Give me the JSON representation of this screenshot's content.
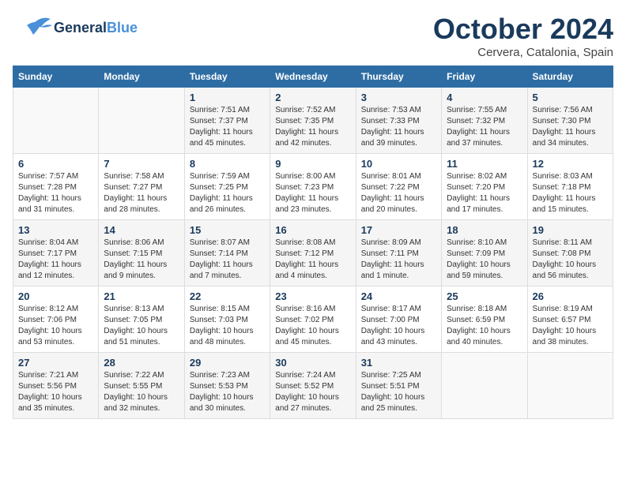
{
  "logo": {
    "general": "General",
    "blue": "Blue"
  },
  "header": {
    "month": "October 2024",
    "location": "Cervera, Catalonia, Spain"
  },
  "weekdays": [
    "Sunday",
    "Monday",
    "Tuesday",
    "Wednesday",
    "Thursday",
    "Friday",
    "Saturday"
  ],
  "weeks": [
    [
      {
        "day": "",
        "info": ""
      },
      {
        "day": "",
        "info": ""
      },
      {
        "day": "1",
        "info": "Sunrise: 7:51 AM\nSunset: 7:37 PM\nDaylight: 11 hours and 45 minutes."
      },
      {
        "day": "2",
        "info": "Sunrise: 7:52 AM\nSunset: 7:35 PM\nDaylight: 11 hours and 42 minutes."
      },
      {
        "day": "3",
        "info": "Sunrise: 7:53 AM\nSunset: 7:33 PM\nDaylight: 11 hours and 39 minutes."
      },
      {
        "day": "4",
        "info": "Sunrise: 7:55 AM\nSunset: 7:32 PM\nDaylight: 11 hours and 37 minutes."
      },
      {
        "day": "5",
        "info": "Sunrise: 7:56 AM\nSunset: 7:30 PM\nDaylight: 11 hours and 34 minutes."
      }
    ],
    [
      {
        "day": "6",
        "info": "Sunrise: 7:57 AM\nSunset: 7:28 PM\nDaylight: 11 hours and 31 minutes."
      },
      {
        "day": "7",
        "info": "Sunrise: 7:58 AM\nSunset: 7:27 PM\nDaylight: 11 hours and 28 minutes."
      },
      {
        "day": "8",
        "info": "Sunrise: 7:59 AM\nSunset: 7:25 PM\nDaylight: 11 hours and 26 minutes."
      },
      {
        "day": "9",
        "info": "Sunrise: 8:00 AM\nSunset: 7:23 PM\nDaylight: 11 hours and 23 minutes."
      },
      {
        "day": "10",
        "info": "Sunrise: 8:01 AM\nSunset: 7:22 PM\nDaylight: 11 hours and 20 minutes."
      },
      {
        "day": "11",
        "info": "Sunrise: 8:02 AM\nSunset: 7:20 PM\nDaylight: 11 hours and 17 minutes."
      },
      {
        "day": "12",
        "info": "Sunrise: 8:03 AM\nSunset: 7:18 PM\nDaylight: 11 hours and 15 minutes."
      }
    ],
    [
      {
        "day": "13",
        "info": "Sunrise: 8:04 AM\nSunset: 7:17 PM\nDaylight: 11 hours and 12 minutes."
      },
      {
        "day": "14",
        "info": "Sunrise: 8:06 AM\nSunset: 7:15 PM\nDaylight: 11 hours and 9 minutes."
      },
      {
        "day": "15",
        "info": "Sunrise: 8:07 AM\nSunset: 7:14 PM\nDaylight: 11 hours and 7 minutes."
      },
      {
        "day": "16",
        "info": "Sunrise: 8:08 AM\nSunset: 7:12 PM\nDaylight: 11 hours and 4 minutes."
      },
      {
        "day": "17",
        "info": "Sunrise: 8:09 AM\nSunset: 7:11 PM\nDaylight: 11 hours and 1 minute."
      },
      {
        "day": "18",
        "info": "Sunrise: 8:10 AM\nSunset: 7:09 PM\nDaylight: 10 hours and 59 minutes."
      },
      {
        "day": "19",
        "info": "Sunrise: 8:11 AM\nSunset: 7:08 PM\nDaylight: 10 hours and 56 minutes."
      }
    ],
    [
      {
        "day": "20",
        "info": "Sunrise: 8:12 AM\nSunset: 7:06 PM\nDaylight: 10 hours and 53 minutes."
      },
      {
        "day": "21",
        "info": "Sunrise: 8:13 AM\nSunset: 7:05 PM\nDaylight: 10 hours and 51 minutes."
      },
      {
        "day": "22",
        "info": "Sunrise: 8:15 AM\nSunset: 7:03 PM\nDaylight: 10 hours and 48 minutes."
      },
      {
        "day": "23",
        "info": "Sunrise: 8:16 AM\nSunset: 7:02 PM\nDaylight: 10 hours and 45 minutes."
      },
      {
        "day": "24",
        "info": "Sunrise: 8:17 AM\nSunset: 7:00 PM\nDaylight: 10 hours and 43 minutes."
      },
      {
        "day": "25",
        "info": "Sunrise: 8:18 AM\nSunset: 6:59 PM\nDaylight: 10 hours and 40 minutes."
      },
      {
        "day": "26",
        "info": "Sunrise: 8:19 AM\nSunset: 6:57 PM\nDaylight: 10 hours and 38 minutes."
      }
    ],
    [
      {
        "day": "27",
        "info": "Sunrise: 7:21 AM\nSunset: 5:56 PM\nDaylight: 10 hours and 35 minutes."
      },
      {
        "day": "28",
        "info": "Sunrise: 7:22 AM\nSunset: 5:55 PM\nDaylight: 10 hours and 32 minutes."
      },
      {
        "day": "29",
        "info": "Sunrise: 7:23 AM\nSunset: 5:53 PM\nDaylight: 10 hours and 30 minutes."
      },
      {
        "day": "30",
        "info": "Sunrise: 7:24 AM\nSunset: 5:52 PM\nDaylight: 10 hours and 27 minutes."
      },
      {
        "day": "31",
        "info": "Sunrise: 7:25 AM\nSunset: 5:51 PM\nDaylight: 10 hours and 25 minutes."
      },
      {
        "day": "",
        "info": ""
      },
      {
        "day": "",
        "info": ""
      }
    ]
  ]
}
